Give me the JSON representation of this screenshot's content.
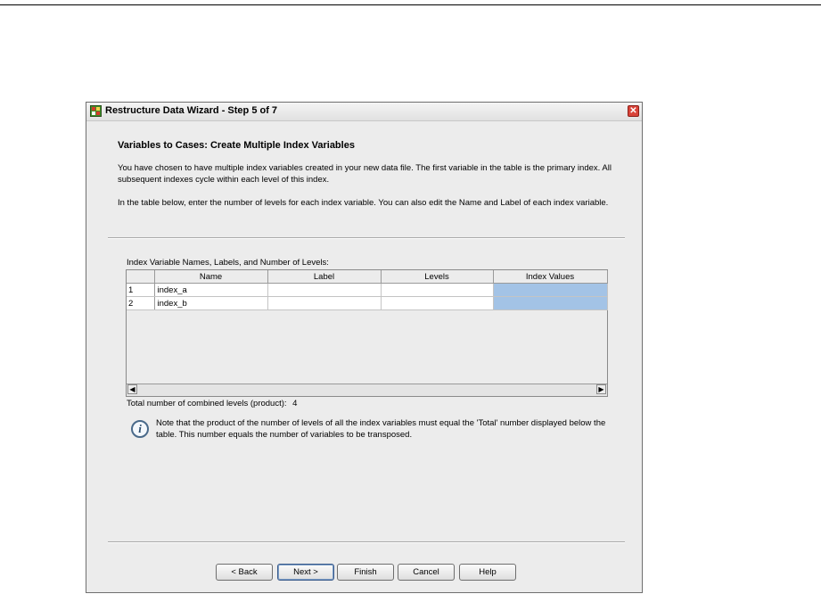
{
  "window": {
    "title": "Restructure Data Wizard - Step 5 of 7",
    "close_glyph": "✕"
  },
  "content": {
    "heading": "Variables to Cases: Create Multiple Index Variables",
    "paragraph1": "You have chosen to have multiple index variables created in your new data file. The first variable in the table is the primary index. All subsequent indexes cycle within each level of this index.",
    "paragraph2": "In the table below, enter the number of levels for each index variable. You can also edit the Name and Label of each index variable."
  },
  "table": {
    "caption": "Index Variable Names, Labels, and Number of Levels:",
    "columns": [
      "",
      "Name",
      "Label",
      "Levels",
      "Index Values"
    ],
    "rows": [
      {
        "num": "1",
        "name": "index_a",
        "label": "",
        "levels": "",
        "index_values": ""
      },
      {
        "num": "2",
        "name": "index_b",
        "label": "",
        "levels": "",
        "index_values": ""
      }
    ],
    "selection_color": "#a3c3e6"
  },
  "total": {
    "label": "Total number of combined levels (product):",
    "value": "4"
  },
  "note": {
    "icon": "info-icon",
    "text": "Note that the product of the number of levels of all the index variables must equal the 'Total' number displayed below the table. This number equals the number of variables to be transposed."
  },
  "buttons": {
    "back": "< Back",
    "next": "Next >",
    "finish": "Finish",
    "cancel": "Cancel",
    "help": "Help"
  },
  "colors": {
    "dialog_background": "#ececec",
    "close_button": "#d9443a"
  }
}
